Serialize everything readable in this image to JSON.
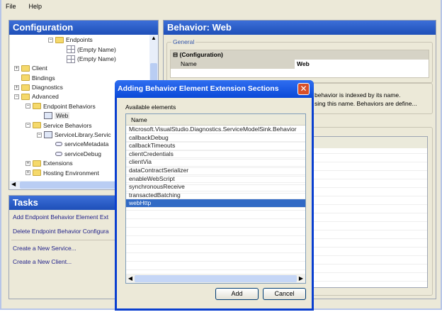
{
  "menu": [
    "File",
    "Help"
  ],
  "config": {
    "title": "Configuration",
    "tree": [
      {
        "label": "Endpoints",
        "icon": "folder",
        "indent": 3,
        "expander": "-"
      },
      {
        "label": "(Empty Name)",
        "icon": "grid",
        "indent": 4,
        "expander": ""
      },
      {
        "label": "(Empty Name)",
        "icon": "grid",
        "indent": 4,
        "expander": ""
      },
      {
        "label": "Client",
        "icon": "folder",
        "indent": 0,
        "expander": "+"
      },
      {
        "label": "Bindings",
        "icon": "folder",
        "indent": 0,
        "expander": ""
      },
      {
        "label": "Diagnostics",
        "icon": "folder",
        "indent": 0,
        "expander": "+"
      },
      {
        "label": "Advanced",
        "icon": "folder",
        "indent": 0,
        "expander": "-"
      },
      {
        "label": "Endpoint Behaviors",
        "icon": "folder",
        "indent": 1,
        "expander": "-"
      },
      {
        "label": "Web",
        "icon": "behavior",
        "indent": 2,
        "expander": "",
        "selected": true
      },
      {
        "label": "Service Behaviors",
        "icon": "folder",
        "indent": 1,
        "expander": "-"
      },
      {
        "label": "ServiceLibrary.Servic",
        "icon": "behavior",
        "indent": 2,
        "expander": "-"
      },
      {
        "label": "serviceMetadata",
        "icon": "element",
        "indent": 3,
        "expander": ""
      },
      {
        "label": "serviceDebug",
        "icon": "element",
        "indent": 3,
        "expander": ""
      },
      {
        "label": "Extensions",
        "icon": "folder",
        "indent": 1,
        "expander": "+"
      },
      {
        "label": "Hosting Environment",
        "icon": "folder",
        "indent": 1,
        "expander": "+"
      }
    ]
  },
  "tasks": {
    "title": "Tasks",
    "items": [
      "Add Endpoint Behavior Element Ext",
      "Delete Endpoint Behavior Configura",
      "Create a New Service...",
      "Create a New Client..."
    ]
  },
  "detail": {
    "title": "Behavior: Web",
    "general_label": "General",
    "section": "(Configuration)",
    "prop_name": "Name",
    "prop_value": "Web",
    "desc1": "behavior is indexed by its name.",
    "desc2": "sing this name. Behaviors are define..."
  },
  "dialog": {
    "title": "Adding Behavior Element Extension Sections",
    "available_label": "Available elements",
    "column": "Name",
    "items": [
      "Microsoft.VisualStudio.Diagnostics.ServiceModelSink.Behavior",
      "callbackDebug",
      "callbackTimeouts",
      "clientCredentials",
      "clientVia",
      "dataContractSerializer",
      "enableWebScript",
      "synchronousReceive",
      "transactedBatching",
      "webHttp"
    ],
    "selected": "webHttp",
    "add": "Add",
    "cancel": "Cancel"
  }
}
